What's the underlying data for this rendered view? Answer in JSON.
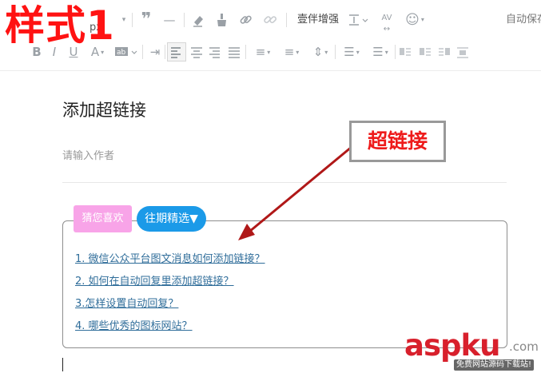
{
  "overlay": {
    "style_title": "样式1"
  },
  "toolbar": {
    "font_size": "px",
    "typeset_label": "壹伴增强",
    "autosave_label": "自动保存",
    "icons": [
      "quote-icon",
      "horizontal-rule-icon",
      "eraser-icon",
      "format-brush-icon",
      "link-icon",
      "unlink-icon",
      "line-height-icon",
      "letter-spacing-icon",
      "emoji-icon",
      "bold-icon",
      "italic-icon",
      "underline-icon",
      "font-color-icon",
      "background-color-icon",
      "indent-icon",
      "align-left-icon",
      "align-center-icon",
      "align-right-icon",
      "align-justify-icon",
      "paragraph-spacing-top-icon",
      "paragraph-spacing-bottom-icon",
      "line-spacing-icon",
      "ordered-list-icon",
      "unordered-list-icon",
      "column-icons"
    ]
  },
  "article": {
    "title": "添加超链接",
    "author_placeholder": "请输入作者"
  },
  "card": {
    "btn_guess": "猜您喜欢",
    "btn_past": "往期精选▼",
    "links": [
      "1. 微信公众平台图文消息如何添加链接？",
      "2. 如何在自动回复里添加超链接？",
      "3.怎样设置自动回复？",
      "4. 哪些优秀的图标网站？"
    ]
  },
  "annotation": {
    "label": "超链接"
  },
  "watermark": {
    "brand_a": "asp",
    "brand_b": "ku",
    "suffix": ".com",
    "tagline": "免费网站源码下载站!"
  },
  "colors": {
    "accent_red": "#ff1212",
    "link": "#2f6d9a",
    "pink": "#f8a4e8",
    "blue": "#1b9ae8"
  }
}
